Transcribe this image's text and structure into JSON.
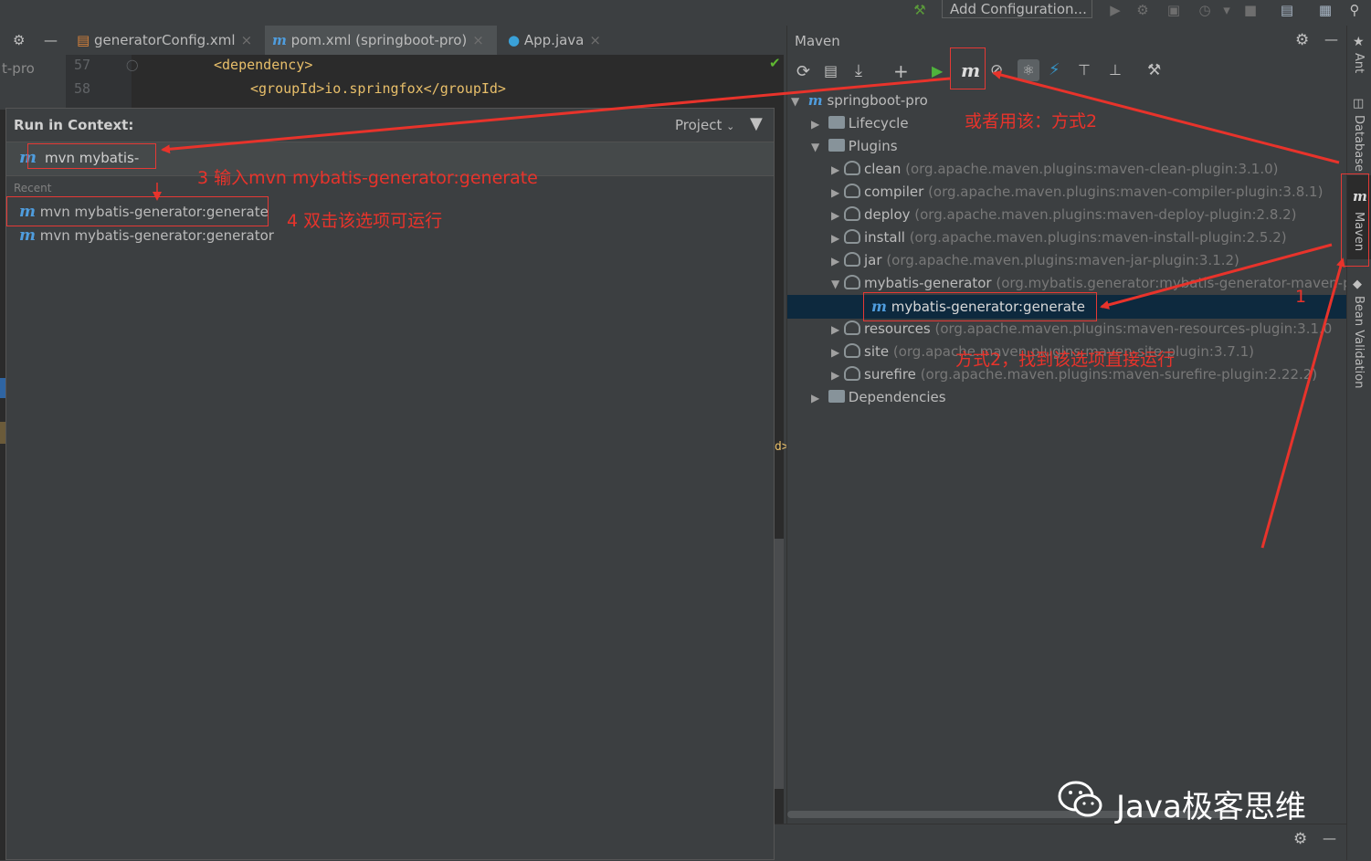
{
  "toolbar": {
    "add_configuration": "Add Configuration..."
  },
  "tabs": [
    {
      "label": "generatorConfig.xml"
    },
    {
      "label": "pom.xml (springboot-pro)"
    },
    {
      "label": "App.java"
    }
  ],
  "editor": {
    "project_label": "t-pro",
    "lines": [
      {
        "num": "57",
        "text": "<dependency>"
      },
      {
        "num": "58",
        "text": "<groupId>io.springfox</groupId>"
      }
    ],
    "stray_fragment": "d>"
  },
  "popup": {
    "title": "Run in Context:",
    "scope": "Project",
    "input_value": "mvn mybatis-",
    "recent_label": "Recent",
    "items": [
      "mvn mybatis-generator:generate",
      "mvn mybatis-generator:generator"
    ]
  },
  "maven": {
    "title": "Maven",
    "root": "springboot-pro",
    "lifecycle": "Lifecycle",
    "plugins": "Plugins",
    "plugin_list": [
      {
        "name": "clean",
        "detail": "(org.apache.maven.plugins:maven-clean-plugin:3.1.0)"
      },
      {
        "name": "compiler",
        "detail": "(org.apache.maven.plugins:maven-compiler-plugin:3.8.1)"
      },
      {
        "name": "deploy",
        "detail": "(org.apache.maven.plugins:maven-deploy-plugin:2.8.2)"
      },
      {
        "name": "install",
        "detail": "(org.apache.maven.plugins:maven-install-plugin:2.5.2)"
      },
      {
        "name": "jar",
        "detail": "(org.apache.maven.plugins:maven-jar-plugin:3.1.2)"
      },
      {
        "name": "mybatis-generator",
        "detail": "(org.mybatis.generator:mybatis-generator-maven-p"
      }
    ],
    "goal": "mybatis-generator:generate",
    "plugin_list_after": [
      {
        "name": "resources",
        "detail": "(org.apache.maven.plugins:maven-resources-plugin:3.1.0"
      },
      {
        "name": "site",
        "detail": "(org.apache.maven.plugins:maven-site-plugin:3.7.1)"
      },
      {
        "name": "surefire",
        "detail": "(org.apache.maven.plugins:maven-surefire-plugin:2.22.2)"
      }
    ],
    "dependencies": "Dependencies"
  },
  "side_strip": {
    "ant": "Ant",
    "database": "Database",
    "maven": "Maven",
    "bean_validation": "Bean Validation"
  },
  "annotations": {
    "step1": "1",
    "step3": "3 输入mvn mybatis-generator:generate",
    "step4": "4 双击该选项可运行",
    "alt_use": "或者用该：方式2",
    "alt_find": "方式2，找到该选项直接运行"
  },
  "watermark": "Java极客思维",
  "colors": {
    "annotation_red": "#e8332b",
    "maven_icon_blue": "#4f9dde",
    "selection": "#0d293e",
    "xml_tag": "#e8bf6a"
  }
}
